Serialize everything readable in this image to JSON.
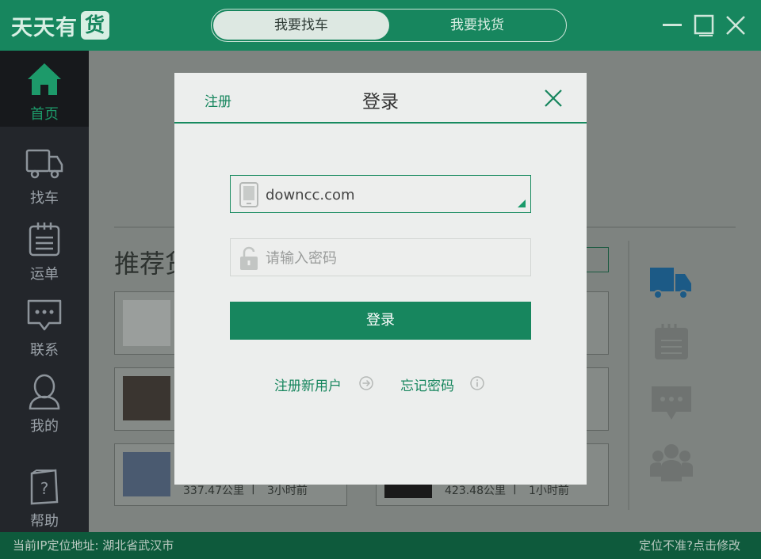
{
  "app": {
    "logo_text": "天天有",
    "logo_badge": "货"
  },
  "header": {
    "tabs": [
      {
        "label": "我要找车",
        "active": true
      },
      {
        "label": "我要找货",
        "active": false
      }
    ],
    "window_controls": [
      "minimize-icon",
      "maximize-icon",
      "close-icon"
    ]
  },
  "sidebar": {
    "items": [
      {
        "label": "首页",
        "icon": "home-icon",
        "active": true
      },
      {
        "label": "找车",
        "icon": "truck-icon"
      },
      {
        "label": "运单",
        "icon": "waybill-icon"
      },
      {
        "label": "联系",
        "icon": "chat-icon"
      },
      {
        "label": "我的",
        "icon": "user-icon"
      },
      {
        "label": "帮助",
        "icon": "help-icon"
      }
    ]
  },
  "background": {
    "section_title": "推荐货",
    "cards": [
      {
        "distance": "337.47公里",
        "separator": "|",
        "time": "3小时前"
      },
      {
        "distance": "423.48公里",
        "separator": "|",
        "time": "1小时前"
      }
    ]
  },
  "status_bar": {
    "location": "当前IP定位地址: 湖北省武汉市",
    "fix_link": "定位不准?点击修改"
  },
  "colors": {
    "brand": "#17865e",
    "sidebar": "#23262b"
  },
  "login_dialog": {
    "register_link": "注册",
    "title": "登录",
    "username_value": "downcc.com",
    "password_placeholder": "请输入密码",
    "login_button": "登录",
    "register_new_user": "注册新用户",
    "forgot_password": "忘记密码"
  }
}
